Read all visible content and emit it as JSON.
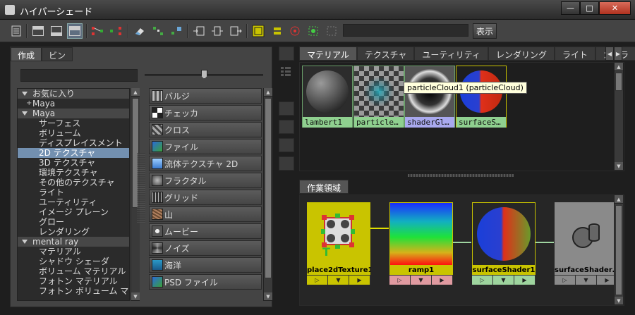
{
  "window": {
    "title": "ハイパーシェード",
    "controls": [
      "—",
      "□",
      "✕"
    ]
  },
  "toolbar": {
    "show_label": "表示",
    "search_value": ""
  },
  "left_panel": {
    "tabs": [
      "作成",
      "ビン"
    ],
    "filter_value": "",
    "slider_value": 0.5,
    "tree": [
      {
        "label": "お気に入り",
        "kind": "head"
      },
      {
        "label": "Maya",
        "kind": "sub"
      },
      {
        "label": "Maya",
        "kind": "head"
      },
      {
        "label": "サーフェス",
        "kind": "item"
      },
      {
        "label": "ボリューム",
        "kind": "item"
      },
      {
        "label": "ディスプレイスメント",
        "kind": "item"
      },
      {
        "label": "2D テクスチャ",
        "kind": "item",
        "selected": true
      },
      {
        "label": "3D テクスチャ",
        "kind": "item"
      },
      {
        "label": "環境テクスチャ",
        "kind": "item"
      },
      {
        "label": "その他のテクスチャ",
        "kind": "item"
      },
      {
        "label": "ライト",
        "kind": "item"
      },
      {
        "label": "ユーティリティ",
        "kind": "item"
      },
      {
        "label": "イメージ プレーン",
        "kind": "item"
      },
      {
        "label": "グロー",
        "kind": "item"
      },
      {
        "label": "レンダリング",
        "kind": "item"
      },
      {
        "label": "mental ray",
        "kind": "head"
      },
      {
        "label": "マテリアル",
        "kind": "item"
      },
      {
        "label": "シャドウ シェーダ",
        "kind": "item"
      },
      {
        "label": "ボリューム マテリアル",
        "kind": "item"
      },
      {
        "label": "フォトン マテリアル",
        "kind": "item"
      },
      {
        "label": "フォトン ボリューム マテ…",
        "kind": "item"
      }
    ],
    "nodes": [
      {
        "label": "バルジ",
        "icon": "bulge-icon"
      },
      {
        "label": "チェッカ",
        "icon": "checker-icon"
      },
      {
        "label": "クロス",
        "icon": "cloth-icon"
      },
      {
        "label": "ファイル",
        "icon": "file-icon"
      },
      {
        "label": "流体テクスチャ 2D",
        "icon": "fluid-texture-icon"
      },
      {
        "label": "フラクタル",
        "icon": "fractal-icon"
      },
      {
        "label": "グリッド",
        "icon": "grid-icon"
      },
      {
        "label": "山",
        "icon": "mountain-icon"
      },
      {
        "label": "ムービー",
        "icon": "movie-icon"
      },
      {
        "label": "ノイズ",
        "icon": "noise-icon"
      },
      {
        "label": "海洋",
        "icon": "ocean-icon"
      },
      {
        "label": "PSD ファイル",
        "icon": "psd-file-icon"
      }
    ]
  },
  "right_panel": {
    "tabs": [
      "マテリアル",
      "テクスチャ",
      "ユーティリティ",
      "レンダリング",
      "ライト",
      "カメラ"
    ],
    "active_tab": 0,
    "swatches": [
      {
        "label": "lambert1",
        "icon": "lambert-sphere-icon"
      },
      {
        "label": "particle…",
        "icon": "particle-cloud-icon"
      },
      {
        "label": "shaderGl…",
        "icon": "shader-glow-icon"
      },
      {
        "label": "surfaceS…",
        "icon": "surface-shader-icon"
      }
    ],
    "tooltip": "particleCloud1 (particleCloud)",
    "work_area_tab": "作業領域",
    "graph_nodes": [
      {
        "label": "place2dTexture1",
        "icon": "place2d-icon"
      },
      {
        "label": "ramp1",
        "icon": "ramp-icon"
      },
      {
        "label": "surfaceShader1",
        "icon": "surface-shader-icon"
      },
      {
        "label": "surfaceShader…",
        "icon": "shading-group-icon"
      }
    ]
  },
  "colors": {
    "selected_row": "#7390b0",
    "material_label": "#8fd08f",
    "texture_node": "#c9c400",
    "ramp_label": "#e09aa0",
    "surface_label": "#9ed49e"
  }
}
